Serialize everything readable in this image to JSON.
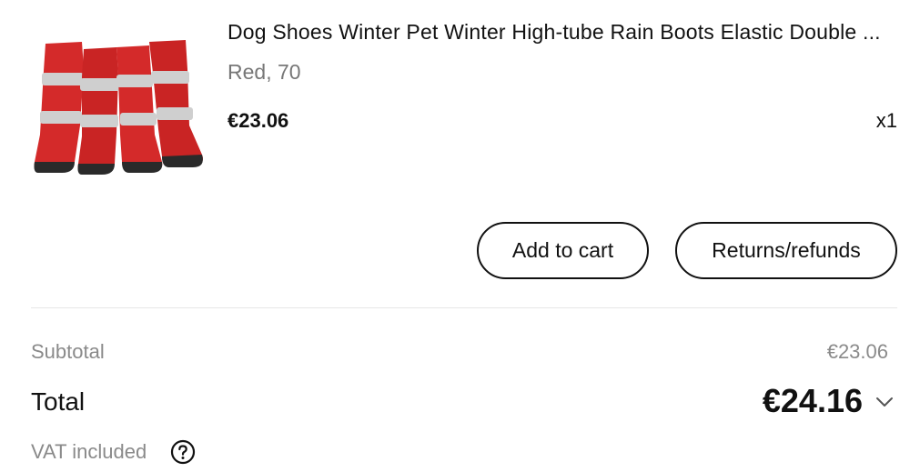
{
  "product": {
    "title": "Dog Shoes Winter Pet Winter High-tube Rain Boots Elastic Double ...",
    "variant": "Red, 70",
    "price": "€23.06",
    "quantity": "x1",
    "image_icon": "red-dog-boots-image"
  },
  "actions": {
    "add_to_cart": "Add to cart",
    "returns_refunds": "Returns/refunds"
  },
  "summary": {
    "subtotal_label": "Subtotal",
    "subtotal_value": "€23.06",
    "total_label": "Total",
    "total_value": "€24.16",
    "vat_label": "VAT included"
  },
  "colors": {
    "boot_red": "#d42a2a",
    "reflective_strip": "#cfcfcf",
    "text_primary": "#111111",
    "text_secondary": "#8a8a8a"
  }
}
